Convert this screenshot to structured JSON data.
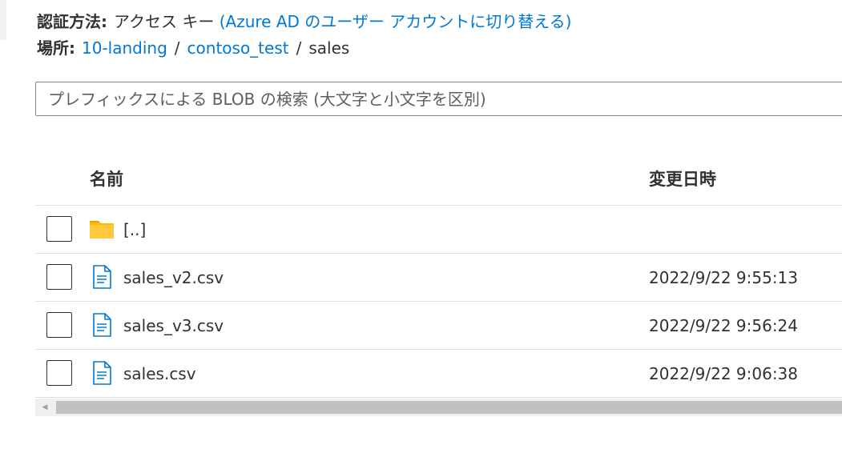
{
  "auth": {
    "label": "認証方法:",
    "value": "アクセス キー",
    "switch_link": "(Azure AD のユーザー アカウントに切り替える)"
  },
  "location": {
    "label": "場所:",
    "crumbs": [
      "10-landing",
      "contoso_test",
      "sales"
    ],
    "separator": "/"
  },
  "search": {
    "placeholder": "プレフィックスによる BLOB の検索 (大文字と小文字を区別)"
  },
  "table": {
    "columns": {
      "name": "名前",
      "modified": "変更日時"
    },
    "rows": [
      {
        "name": "[..]",
        "modified": "",
        "icon": "folder-icon"
      },
      {
        "name": "sales_v2.csv",
        "modified": "2022/9/22 9:55:13",
        "icon": "file-icon"
      },
      {
        "name": "sales_v3.csv",
        "modified": "2022/9/22 9:56:24",
        "icon": "file-icon"
      },
      {
        "name": "sales.csv",
        "modified": "2022/9/22 9:06:38",
        "icon": "file-icon"
      }
    ]
  },
  "colors": {
    "link": "#0078d4",
    "folder": "#ffb900",
    "file": "#0078d4"
  }
}
